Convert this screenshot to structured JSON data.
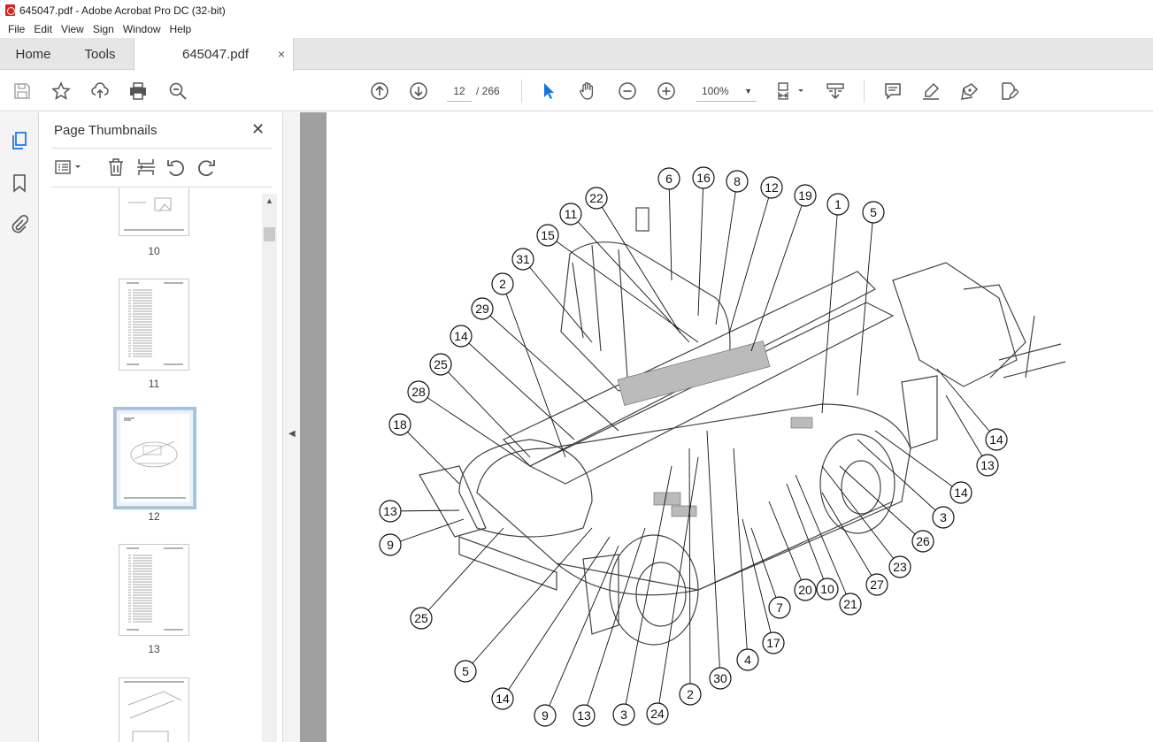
{
  "window": {
    "title": "645047.pdf - Adobe Acrobat Pro DC (32-bit)"
  },
  "menu": [
    "File",
    "Edit",
    "View",
    "Sign",
    "Window",
    "Help"
  ],
  "tabs": {
    "home": "Home",
    "tools": "Tools",
    "document": "645047.pdf",
    "close_glyph": "×"
  },
  "toolbar": {
    "current_page": "12",
    "page_of": "/ 266",
    "zoom": "100%"
  },
  "panel": {
    "title": "Page Thumbnails",
    "close_glyph": "✕",
    "thumbnails": [
      {
        "label": "10"
      },
      {
        "label": "11"
      },
      {
        "label": "12",
        "selected": true
      },
      {
        "label": "13"
      }
    ]
  },
  "drawing": {
    "callouts": [
      "6",
      "16",
      "8",
      "12",
      "22",
      "19",
      "11",
      "1",
      "5",
      "15",
      "31",
      "2",
      "29",
      "14",
      "25",
      "28",
      "18",
      "13",
      "9",
      "25",
      "5",
      "14",
      "9",
      "13",
      "3",
      "24",
      "2",
      "30",
      "4",
      "17",
      "7",
      "20",
      "10",
      "21",
      "27",
      "23",
      "26",
      "3",
      "14",
      "13",
      "14"
    ]
  }
}
